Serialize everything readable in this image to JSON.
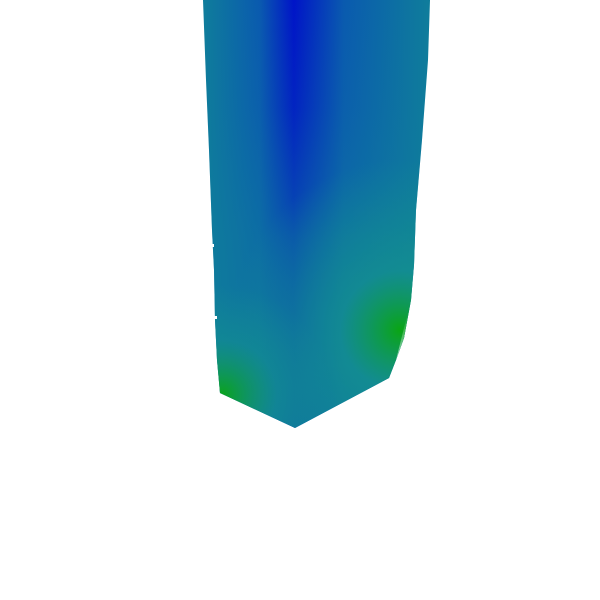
{
  "scene": {
    "background_color": "#ffffff",
    "object": "prism-shape",
    "colors": {
      "deep_blue": "#0014c8",
      "teal": "#0f7d9b",
      "teal_green": "#14968c",
      "green": "#0aa514",
      "highlight": "#f5fff5"
    }
  }
}
